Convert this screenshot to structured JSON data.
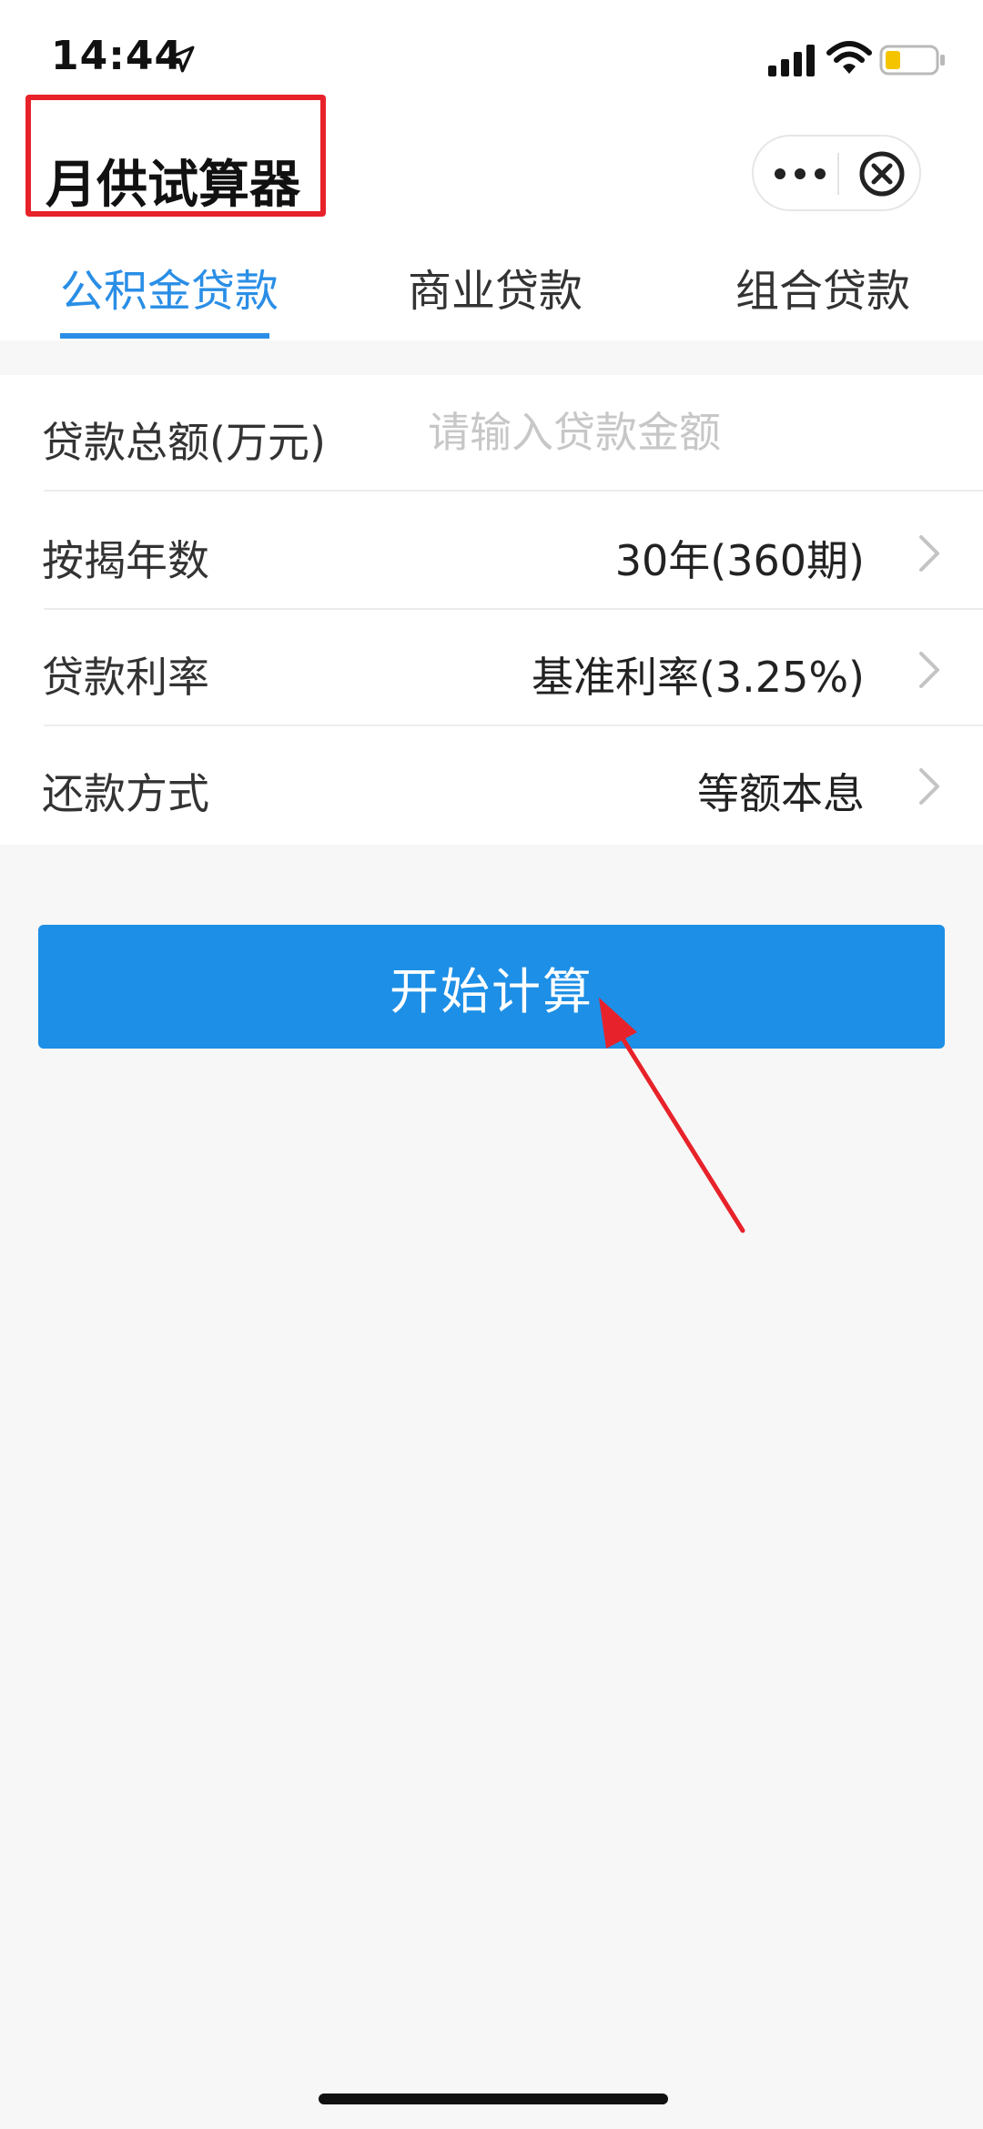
{
  "status_bar": {
    "time": "14:44",
    "icons": [
      "location-arrow-icon",
      "cellular-signal-icon",
      "wifi-icon",
      "battery-icon"
    ],
    "battery_color": "#f5c400"
  },
  "nav_bar": {
    "title": "月供试算器",
    "title_highlight_color": "#e8222a",
    "icons": [
      "more-icon",
      "close-icon"
    ]
  },
  "tabs": [
    {
      "label": "公积金贷款",
      "active": true
    },
    {
      "label": "商业贷款",
      "active": false
    },
    {
      "label": "组合贷款",
      "active": false
    }
  ],
  "form": {
    "amount": {
      "label": "贷款总额(万元)",
      "value": "",
      "placeholder": "请输入贷款金额"
    },
    "years": {
      "label": "按揭年数",
      "value": "30年(360期)"
    },
    "rate": {
      "label": "贷款利率",
      "value": "基准利率(3.25%)"
    },
    "method": {
      "label": "还款方式",
      "value": "等额本息"
    }
  },
  "calc_button": {
    "label": "开始计算"
  },
  "colors": {
    "accent": "#2a8ee6",
    "button": "#1d8fe6",
    "annotation": "#e8222a",
    "background": "#f7f7f7"
  }
}
